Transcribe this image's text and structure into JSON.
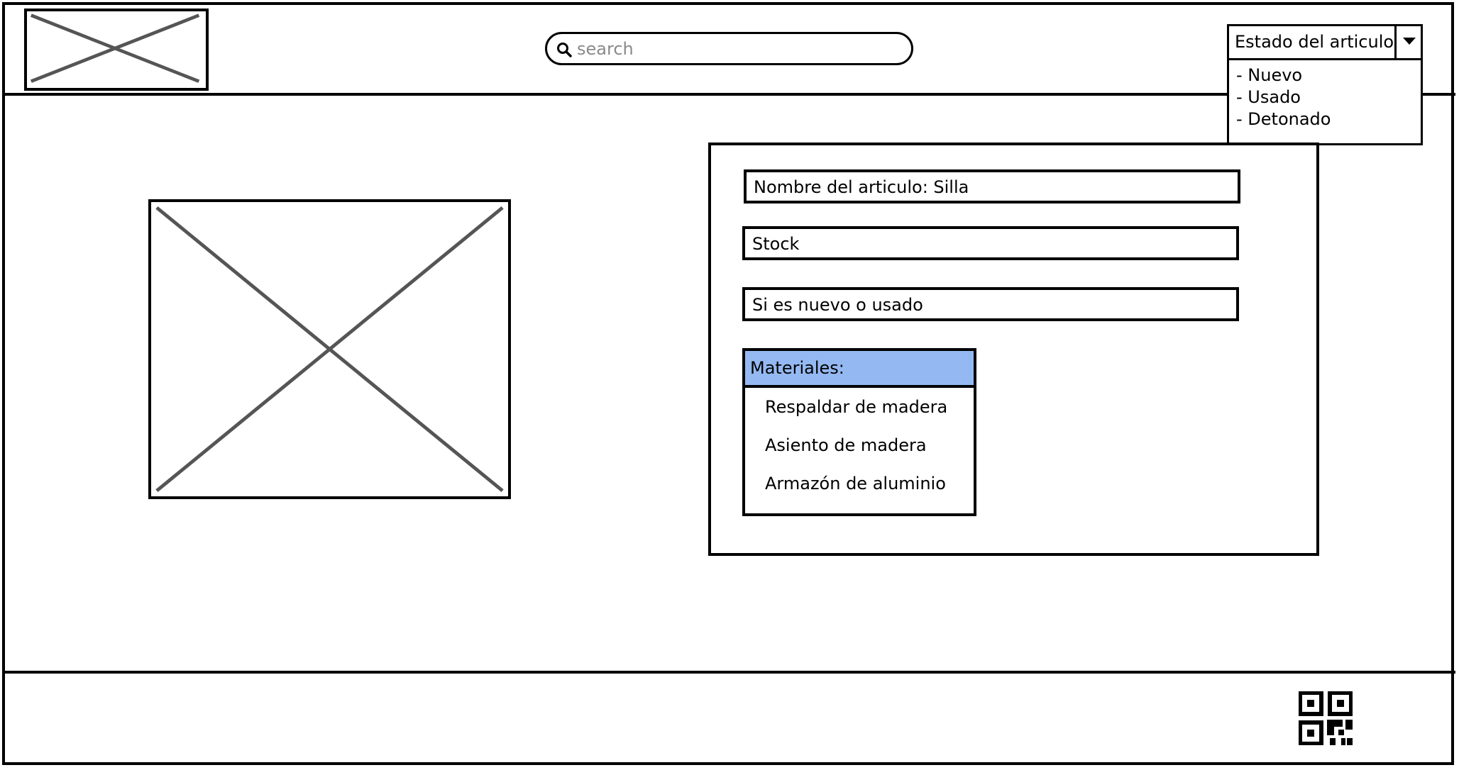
{
  "header": {
    "logo_name": "logo-placeholder",
    "search": {
      "placeholder": "search",
      "value": ""
    },
    "state_selector": {
      "label": "Estado del articulo",
      "options": [
        "- Nuevo",
        "- Usado",
        "- Detonado"
      ]
    }
  },
  "product": {
    "name_field": "Nombre del articulo: Silla",
    "stock_field": "Stock",
    "condition_field": "Si es nuevo o usado",
    "materials": {
      "header": "Materiales:",
      "items": [
        "Respaldar de madera",
        "Asiento de madera",
        "Armazón de aluminio"
      ]
    }
  },
  "footer": {
    "qr_icon": "qr-code-icon"
  },
  "colors": {
    "accent_header": "#94b9f2",
    "placeholder_cross": "#555555"
  }
}
